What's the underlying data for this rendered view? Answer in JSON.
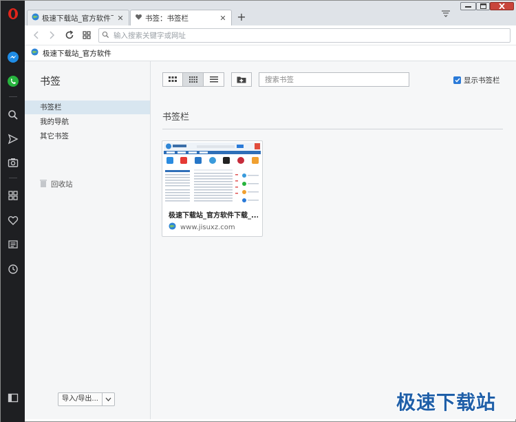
{
  "tabs": [
    {
      "title": "极速下载站_官方软件下载",
      "active": false,
      "icon": "globe-icon"
    },
    {
      "title": "书签：书签栏",
      "active": true,
      "icon": "heart-icon"
    }
  ],
  "address_bar": {
    "placeholder": "输入搜索关键字或网址"
  },
  "bookmarks_bar": {
    "item_label": "极速下载站_官方软件"
  },
  "sidebar": {
    "title": "书签",
    "items": [
      {
        "label": "书签栏",
        "selected": true
      },
      {
        "label": "我的导航",
        "selected": false
      },
      {
        "label": "其它书签",
        "selected": false
      }
    ],
    "trash_label": "回收站",
    "import_label": "导入/导出..."
  },
  "toolbar": {
    "search_placeholder": "搜索书签",
    "show_bar_label": "显示书签栏",
    "show_bar_checked": true
  },
  "section_title": "书签栏",
  "bookmark_card": {
    "title": "极速下载站_官方软件下载_...",
    "url": "www.jisuxz.com"
  },
  "watermark": "极速下载站",
  "colors": {
    "accent": "#2a7ad8",
    "sidebar_dark": "#1e1f22",
    "opera_red": "#e1251b"
  }
}
